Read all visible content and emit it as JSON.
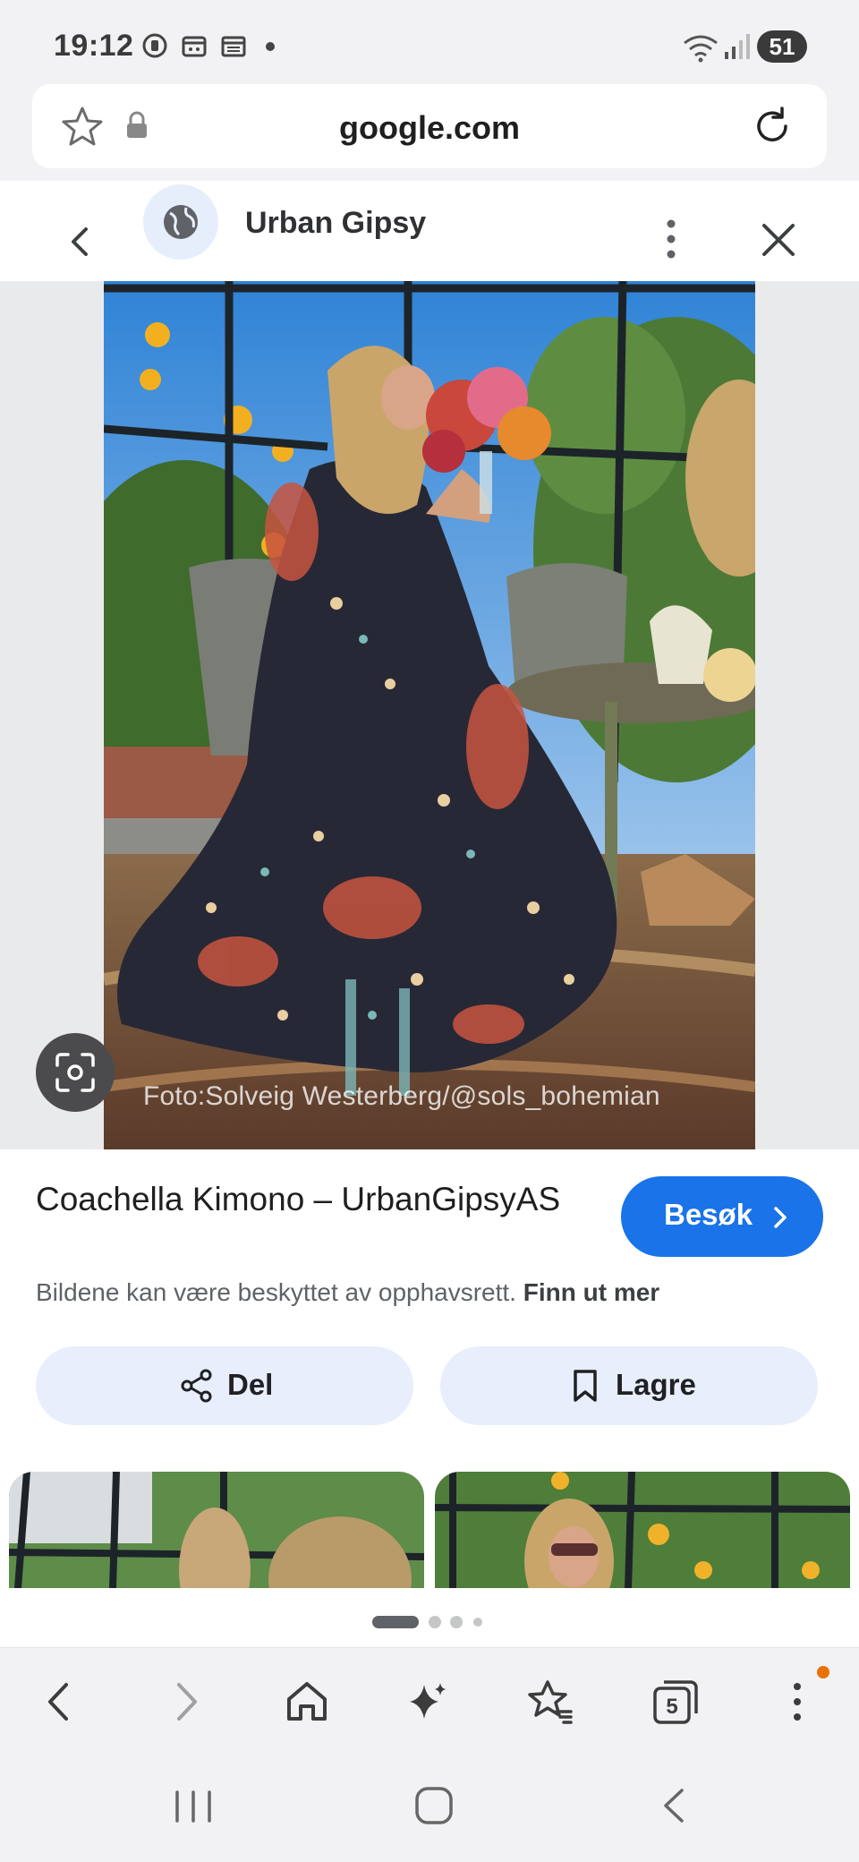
{
  "status": {
    "time": "19:12",
    "battery": "51",
    "icons": [
      "notification-icon",
      "calendar-icon",
      "calendar-icon",
      "dot-icon",
      "wifi-icon",
      "signal-icon",
      "battery-icon"
    ]
  },
  "browser": {
    "url": "google.com",
    "icons": [
      "star-icon",
      "lock-icon",
      "reload-icon"
    ]
  },
  "lens": {
    "site_name": "Urban Gipsy",
    "icons": [
      "back-icon",
      "globe-icon",
      "more-icon",
      "close-icon"
    ]
  },
  "image": {
    "credit": "Foto:Solveig Westerberg/@sols_bohemian"
  },
  "result": {
    "title": "Coachella Kimono – UrbanGipsyAS",
    "visit_label": "Besøk",
    "copyright": "Bildene kan være beskyttet av opphavsrett.",
    "learn_more": "Finn ut mer",
    "share_label": "Del",
    "save_label": "Lagre"
  },
  "toolbar": {
    "tabs_count": "5",
    "icons": [
      "back-icon",
      "forward-icon",
      "home-icon",
      "sparkle-icon",
      "bookmark-star-icon",
      "tabs-icon",
      "more-icon"
    ]
  },
  "colors": {
    "accent": "#1a73e8",
    "pill": "#e8eefb",
    "notification": "#e8710a"
  }
}
